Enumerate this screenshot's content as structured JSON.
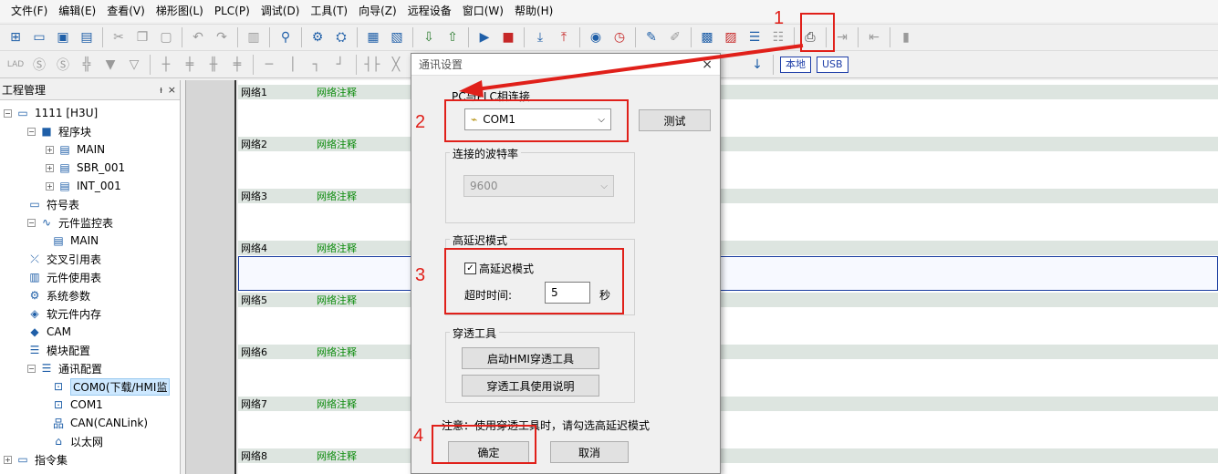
{
  "menu": [
    "文件(F)",
    "编辑(E)",
    "查看(V)",
    "梯形图(L)",
    "PLC(P)",
    "调试(D)",
    "工具(T)",
    "向导(Z)",
    "远程设备",
    "窗口(W)",
    "帮助(H)"
  ],
  "toolbar2": {
    "local_label": "本地",
    "usb_label": "USB"
  },
  "left_panel": {
    "title": "工程管理",
    "pin": "ᵼ",
    "close": "×",
    "tree": [
      {
        "label": "1111 [H3U]",
        "icon": "monitor-icon"
      },
      {
        "label": "程序块",
        "icon": "blocks-icon"
      },
      {
        "label": "MAIN",
        "icon": "program-icon"
      },
      {
        "label": "SBR_001",
        "icon": "program-icon"
      },
      {
        "label": "INT_001",
        "icon": "program-icon"
      },
      {
        "label": "符号表",
        "icon": "symbol-table-icon"
      },
      {
        "label": "元件监控表",
        "icon": "monitor-table-icon"
      },
      {
        "label": "MAIN",
        "icon": "table-icon"
      },
      {
        "label": "交叉引用表",
        "icon": "cross-ref-icon"
      },
      {
        "label": "元件使用表",
        "icon": "db-icon"
      },
      {
        "label": "系统参数",
        "icon": "gear-icon"
      },
      {
        "label": "软元件内存",
        "icon": "memory-icon"
      },
      {
        "label": "CAM",
        "icon": "cam-icon"
      },
      {
        "label": "模块配置",
        "icon": "module-icon"
      },
      {
        "label": "通讯配置",
        "icon": "comm-icon"
      },
      {
        "label": "COM0(下载/HMI监",
        "icon": "serial-port-icon"
      },
      {
        "label": "COM1",
        "icon": "serial-port-icon"
      },
      {
        "label": "CAN(CANLink)",
        "icon": "network-icon"
      },
      {
        "label": "以太网",
        "icon": "ethernet-icon"
      },
      {
        "label": "指令集",
        "icon": "monitor-icon"
      }
    ]
  },
  "ladder": {
    "rungs": [
      {
        "name": "网络1",
        "comment": "网络注释"
      },
      {
        "name": "网络2",
        "comment": "网络注释"
      },
      {
        "name": "网络3",
        "comment": "网络注释"
      },
      {
        "name": "网络4",
        "comment": "网络注释"
      },
      {
        "name": "网络5",
        "comment": "网络注释"
      },
      {
        "name": "网络6",
        "comment": "网络注释"
      },
      {
        "name": "网络7",
        "comment": "网络注释"
      },
      {
        "name": "网络8",
        "comment": "网络注释"
      }
    ]
  },
  "dialog": {
    "title": "通讯设置",
    "close": "×",
    "pc_plc_group": "PC与PLC相连接",
    "port_value": "COM1",
    "test_button": "测试",
    "baud_group": "连接的波特率",
    "baud_value": "9600",
    "latency_group": "高延迟模式",
    "latency_checkbox": "高延迟模式",
    "checkbox_mark": "✓",
    "timeout_label": "超时时间:",
    "timeout_value": "5",
    "timeout_unit": "秒",
    "passthrough_group": "穿透工具",
    "start_hmi_button": "启动HMI穿透工具",
    "help_button": "穿透工具使用说明",
    "note": "注意：使用穿透工具时，请勾选高延迟模式",
    "ok_button": "确定",
    "cancel_button": "取消"
  },
  "annotations": [
    "1",
    "2",
    "3",
    "4"
  ],
  "colors": {
    "annotation": "#e0201a",
    "comment": "#0a8a0a",
    "selection": "#cde8ff"
  }
}
